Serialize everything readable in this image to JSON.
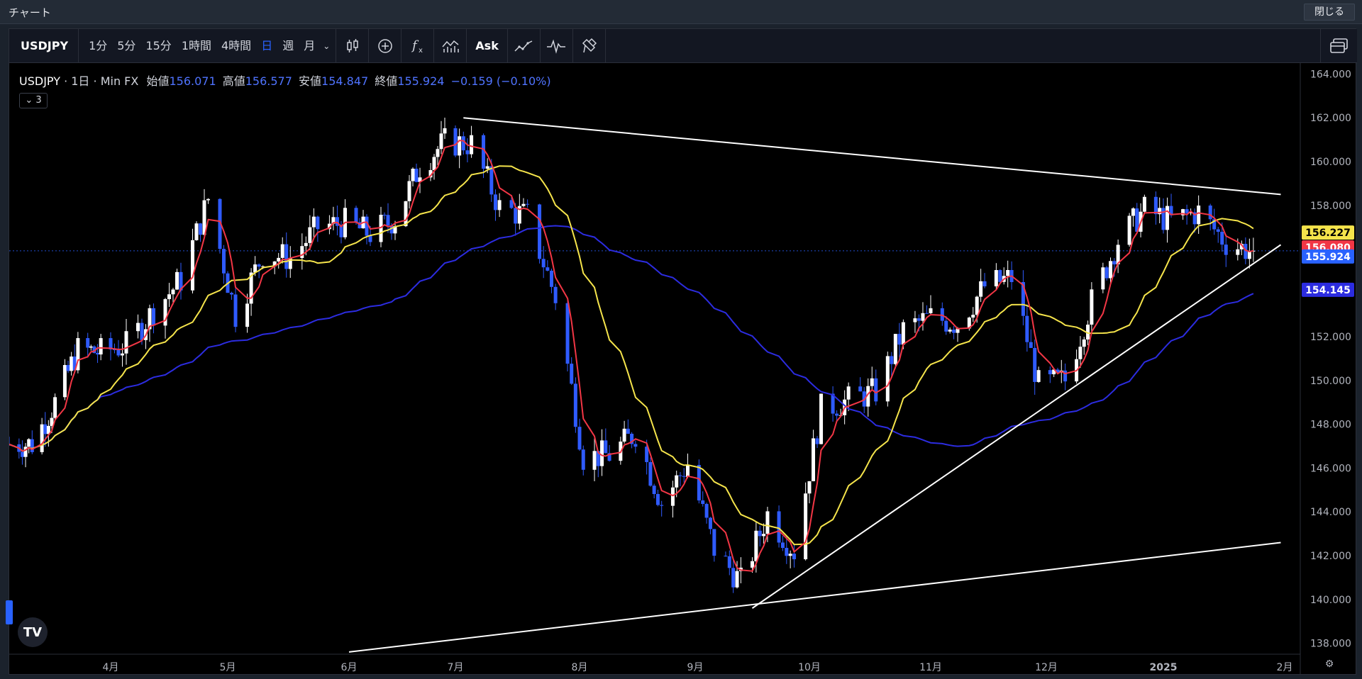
{
  "window": {
    "title": "チャート",
    "close_label": "閉じる"
  },
  "toolbar": {
    "symbol": "USDJPY",
    "intervals": [
      "1分",
      "5分",
      "15分",
      "1時間",
      "4時間",
      "日",
      "週",
      "月"
    ],
    "active_interval": "日",
    "ask_label": "Ask",
    "icons": [
      "candles-icon",
      "add-indicator-icon",
      "function-icon",
      "chart-style-icon",
      "compare-icon",
      "indicator-template-icon",
      "brush-icon",
      "layout-icon"
    ]
  },
  "legend": {
    "symbol": "USDJPY",
    "interval": "1日",
    "source": "Min FX",
    "open_label": "始値",
    "open": "156.071",
    "high_label": "高値",
    "high": "156.577",
    "low_label": "安値",
    "low": "154.847",
    "close_label": "終値",
    "close": "155.924",
    "change": "−0.159 (−0.10%)",
    "collapse_count": "3"
  },
  "price_labels": [
    {
      "value": "156.227",
      "color": "#f5e44b",
      "text_color": "#000000"
    },
    {
      "value": "156.080",
      "color": "#f23645",
      "text_color": "#ffffff"
    },
    {
      "value": "155.924",
      "color": "#2962ff",
      "text_color": "#ffffff"
    },
    {
      "value": "154.145",
      "color": "#2c2ce0",
      "text_color": "#ffffff"
    }
  ],
  "chart_data": {
    "type": "line",
    "symbol": "USDJPY",
    "timeframe": "1日",
    "ylim": [
      137.5,
      164.5
    ],
    "y_ticks": [
      "164.000",
      "162.000",
      "160.000",
      "158.000",
      "156.000",
      "154.000",
      "152.000",
      "150.000",
      "148.000",
      "146.000",
      "144.000",
      "142.000",
      "140.000",
      "138.000"
    ],
    "x_ticks": [
      "4月",
      "5月",
      "6月",
      "7月",
      "8月",
      "9月",
      "10月",
      "11月",
      "12月",
      "2025",
      "2月"
    ],
    "last_price": 155.924,
    "colors": {
      "up": "#ffffff",
      "down": "#2f5bff",
      "ma_fast": "#f23645",
      "ma_mid": "#f5e44b",
      "ma_slow": "#2c2ce0",
      "trendlines": "#ffffff"
    },
    "close_series": [
      {
        "date": "2024-03-08",
        "close": 147.1
      },
      {
        "date": "2024-03-15",
        "close": 149.0
      },
      {
        "date": "2024-03-22",
        "close": 151.4
      },
      {
        "date": "2024-03-29",
        "close": 151.3
      },
      {
        "date": "2024-04-05",
        "close": 151.6
      },
      {
        "date": "2024-04-12",
        "close": 153.2
      },
      {
        "date": "2024-04-19",
        "close": 154.6
      },
      {
        "date": "2024-04-26",
        "close": 158.3
      },
      {
        "date": "2024-05-03",
        "close": 153.0
      },
      {
        "date": "2024-05-10",
        "close": 155.8
      },
      {
        "date": "2024-05-17",
        "close": 155.6
      },
      {
        "date": "2024-05-24",
        "close": 157.0
      },
      {
        "date": "2024-05-31",
        "close": 157.2
      },
      {
        "date": "2024-06-07",
        "close": 156.7
      },
      {
        "date": "2024-06-14",
        "close": 157.4
      },
      {
        "date": "2024-06-21",
        "close": 159.8
      },
      {
        "date": "2024-06-28",
        "close": 160.9
      },
      {
        "date": "2024-07-05",
        "close": 160.8
      },
      {
        "date": "2024-07-12",
        "close": 157.9
      },
      {
        "date": "2024-07-19",
        "close": 157.5
      },
      {
        "date": "2024-07-26",
        "close": 153.8
      },
      {
        "date": "2024-08-02",
        "close": 146.5
      },
      {
        "date": "2024-08-09",
        "close": 146.6
      },
      {
        "date": "2024-08-16",
        "close": 147.6
      },
      {
        "date": "2024-08-23",
        "close": 144.4
      },
      {
        "date": "2024-08-30",
        "close": 146.2
      },
      {
        "date": "2024-09-06",
        "close": 142.3
      },
      {
        "date": "2024-09-13",
        "close": 140.8
      },
      {
        "date": "2024-09-20",
        "close": 143.9
      },
      {
        "date": "2024-09-27",
        "close": 142.2
      },
      {
        "date": "2024-10-04",
        "close": 148.7
      },
      {
        "date": "2024-10-11",
        "close": 149.1
      },
      {
        "date": "2024-10-18",
        "close": 149.5
      },
      {
        "date": "2024-10-25",
        "close": 152.3
      },
      {
        "date": "2024-11-01",
        "close": 152.9
      },
      {
        "date": "2024-11-08",
        "close": 152.6
      },
      {
        "date": "2024-11-15",
        "close": 154.3
      },
      {
        "date": "2024-11-22",
        "close": 154.7
      },
      {
        "date": "2024-11-29",
        "close": 149.8
      },
      {
        "date": "2024-12-06",
        "close": 150.0
      },
      {
        "date": "2024-12-13",
        "close": 153.6
      },
      {
        "date": "2024-12-20",
        "close": 156.4
      },
      {
        "date": "2024-12-27",
        "close": 157.8
      },
      {
        "date": "2025-01-03",
        "close": 157.3
      },
      {
        "date": "2025-01-10",
        "close": 157.7
      },
      {
        "date": "2025-01-17",
        "close": 156.3
      },
      {
        "date": "2025-01-24",
        "close": 155.9
      }
    ],
    "trendlines": [
      {
        "name": "upper-resistance",
        "from": {
          "date": "2024-07-03",
          "price": 162.0
        },
        "to": {
          "date": "2025-01-31",
          "price": 158.5
        }
      },
      {
        "name": "rising-support",
        "from": {
          "date": "2024-09-16",
          "price": 139.6
        },
        "to": {
          "date": "2025-01-31",
          "price": 156.2
        }
      },
      {
        "name": "lower-support",
        "from": {
          "date": "2024-06-01",
          "price": 137.6
        },
        "to": {
          "date": "2025-01-31",
          "price": 142.6
        }
      }
    ]
  }
}
